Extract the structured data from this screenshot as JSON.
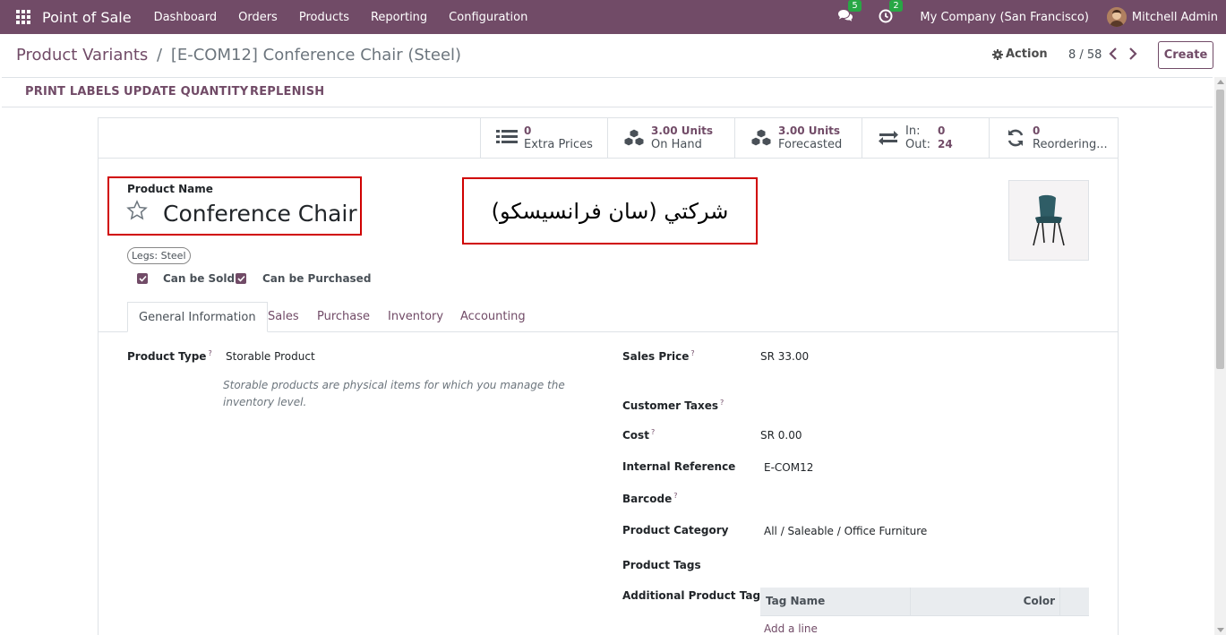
{
  "navbar": {
    "app_name": "Point of Sale",
    "menu": [
      "Dashboard",
      "Orders",
      "Products",
      "Reporting",
      "Configuration"
    ],
    "messages_count": "5",
    "activities_count": "2",
    "company": "My Company (San Francisco)",
    "user": "Mitchell Admin"
  },
  "breadcrumb": {
    "parent": "Product Variants",
    "separator": "/",
    "current": "[E-COM12] Conference Chair (Steel)"
  },
  "control": {
    "action_label": "Action",
    "pager": "8 / 58",
    "create_label": "Create"
  },
  "statusbar": {
    "print_labels": "PRINT LABELS",
    "update_quantity": "UPDATE QUANTITY",
    "replenish": "REPLENISH"
  },
  "smart_buttons": {
    "extra_prices_value": "0",
    "extra_prices_label": "Extra Prices",
    "on_hand_value": "3.00 Units",
    "on_hand_label": "On Hand",
    "forecasted_value": "3.00 Units",
    "forecasted_label": "Forecasted",
    "in_label": "In:",
    "in_value": "0",
    "out_label": "Out:",
    "out_value": "24",
    "reordering_value": "0",
    "reordering_label": "Reordering..."
  },
  "product": {
    "name_label": "Product Name",
    "name": "Conference Chair",
    "arabic_text": "شركتي (سان فرانسيسكو)",
    "attribute_chip": "Legs: Steel",
    "can_be_sold_label": "Can be Sold",
    "can_be_purchased_label": "Can be Purchased"
  },
  "tabs": [
    "General Information",
    "Sales",
    "Purchase",
    "Inventory",
    "Accounting"
  ],
  "general": {
    "product_type_label": "Product Type",
    "product_type_value": "Storable Product",
    "product_type_help": "Storable products are physical items for which you manage the inventory level.",
    "sales_price_label": "Sales Price",
    "sales_price_value": "SR 33.00",
    "customer_taxes_label": "Customer Taxes",
    "cost_label": "Cost",
    "cost_value": "SR 0.00",
    "internal_ref_label": "Internal Reference",
    "internal_ref_value": "E-COM12",
    "barcode_label": "Barcode",
    "category_label": "Product Category",
    "category_value": "All / Saleable / Office Furniture",
    "tags_label": "Product Tags",
    "additional_tags_label": "Additional Product Tag",
    "help_marker": "?"
  },
  "tag_table": {
    "col_name": "Tag Name",
    "col_color": "Color",
    "add_line": "Add a line"
  },
  "colors": {
    "brand": "#714b67",
    "badge": "#28a745",
    "highlight_box": "#d00000"
  }
}
